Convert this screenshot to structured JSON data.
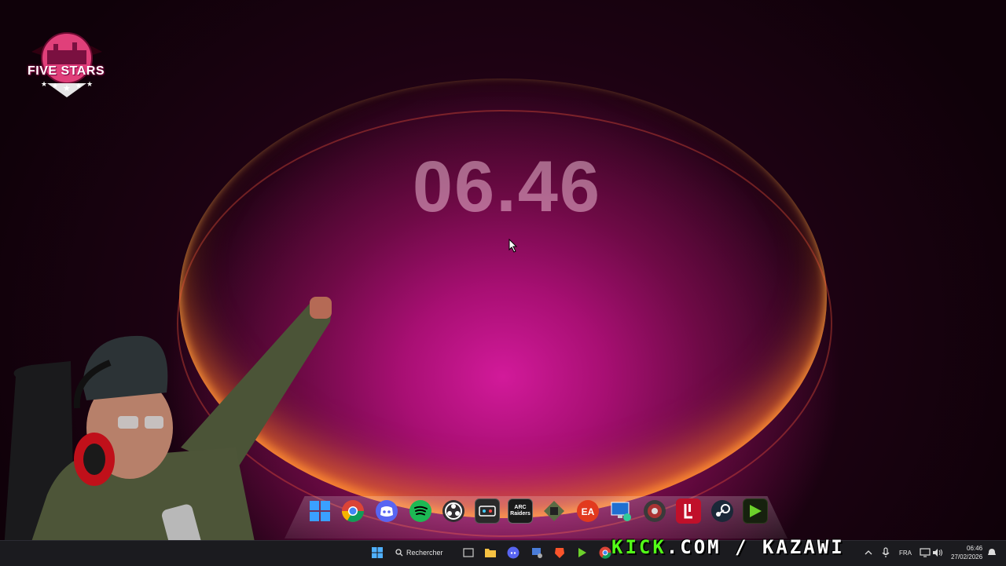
{
  "overlay": {
    "logo_text": "FIVE STARS",
    "stream_url_prefix": "KICK",
    "stream_url_rest": ".COM / KAZAWI"
  },
  "desktop": {
    "clock": "06.46"
  },
  "dock": {
    "icons": [
      {
        "name": "windows-icon",
        "color": "#1e90ff"
      },
      {
        "name": "chrome-icon",
        "color": "#db4437"
      },
      {
        "name": "discord-icon",
        "color": "#5865f2"
      },
      {
        "name": "spotify-icon",
        "color": "#1db954"
      },
      {
        "name": "obs-icon",
        "color": "#302e31"
      },
      {
        "name": "msi-icon",
        "color": "#2a2a2a"
      },
      {
        "name": "arc-raiders-icon",
        "color": "#1a1a1a",
        "label": "ARC Raiders"
      },
      {
        "name": "gpu-tool-icon",
        "color": "#4a5a3a"
      },
      {
        "name": "ea-icon",
        "color": "#e23a1e",
        "label": "EA"
      },
      {
        "name": "remote-desktop-icon",
        "color": "#1f6fd1"
      },
      {
        "name": "game-icon",
        "color": "#333"
      },
      {
        "name": "launcher-icon",
        "color": "#c0102a"
      },
      {
        "name": "steam-icon",
        "color": "#1b2838"
      },
      {
        "name": "play-icon",
        "color": "#16210e"
      }
    ]
  },
  "taskbar": {
    "search_label": "Rechercher",
    "language": "FRA",
    "time": "06:46",
    "date": "27/02/2026"
  }
}
